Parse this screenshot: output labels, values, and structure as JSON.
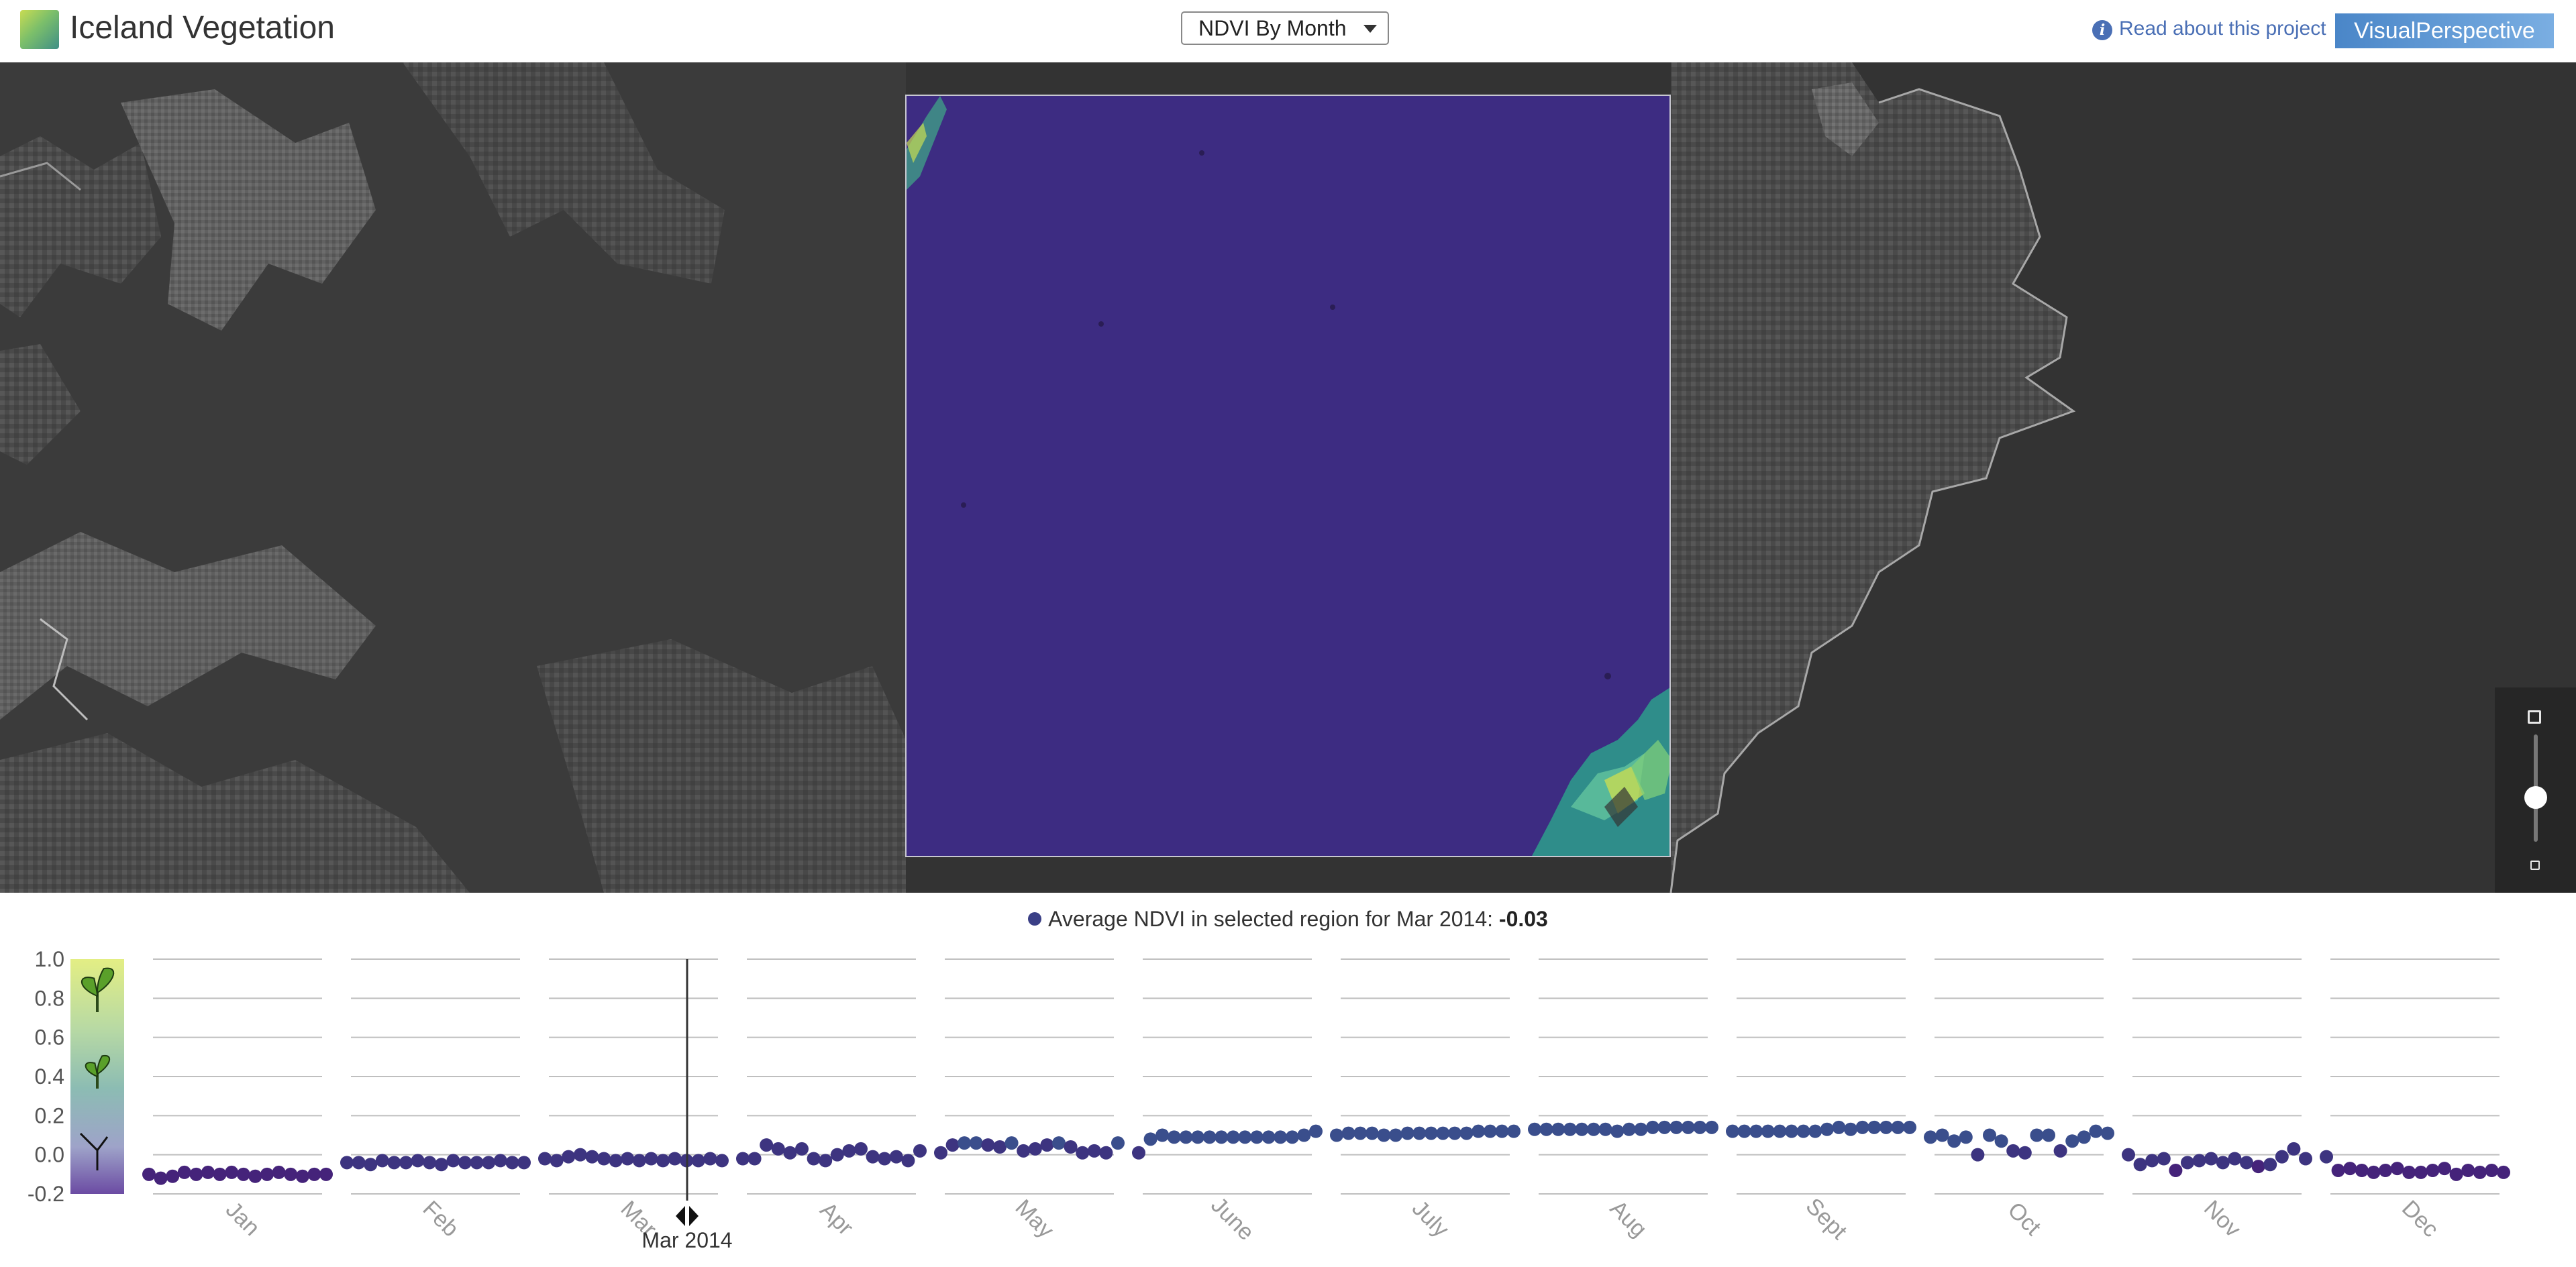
{
  "header": {
    "title": "Iceland Vegetation",
    "select_value": "NDVI By Month",
    "read_link": "Read about this project",
    "info_icon": "info-icon",
    "brand": "VisualPerspective"
  },
  "caption": {
    "prefix": "Average NDVI in selected region for Mar 2014:",
    "value": "-0.03"
  },
  "colors": {
    "low_ndvi": "#3d2c82",
    "series_dot": "#3a3f86",
    "high_ndvi": "#c8dc52"
  },
  "chart_data": {
    "type": "scatter",
    "title": "",
    "ylim": [
      -0.2,
      1.0
    ],
    "y_ticks": [
      "1.0",
      "0.8",
      "0.6",
      "0.4",
      "0.2",
      "0.0",
      "-0.2"
    ],
    "legend_icons": [
      "sprout-large-icon",
      "sprout-small-icon",
      "bare-stem-icon"
    ],
    "selected_label": "Mar 2014",
    "months": [
      {
        "label": "Jan",
        "values": [
          -0.1,
          -0.12,
          -0.11,
          -0.09,
          -0.1,
          -0.09,
          -0.1,
          -0.09,
          -0.1,
          -0.11,
          -0.1,
          -0.09,
          -0.1,
          -0.11,
          -0.1,
          -0.1
        ]
      },
      {
        "label": "Feb",
        "values": [
          -0.04,
          -0.04,
          -0.05,
          -0.03,
          -0.04,
          -0.04,
          -0.03,
          -0.04,
          -0.05,
          -0.03,
          -0.04,
          -0.04,
          -0.04,
          -0.03,
          -0.04,
          -0.04
        ]
      },
      {
        "label": "Mar",
        "values": [
          -0.02,
          -0.03,
          -0.01,
          0.0,
          -0.01,
          -0.02,
          -0.03,
          -0.02,
          -0.03,
          -0.02,
          -0.03,
          -0.02,
          -0.03,
          -0.03,
          -0.02,
          -0.03
        ]
      },
      {
        "label": "Apr",
        "values": [
          -0.02,
          -0.02,
          0.05,
          0.03,
          0.01,
          0.03,
          -0.02,
          -0.03,
          0.0,
          0.02,
          0.03,
          -0.01,
          -0.02,
          -0.01,
          -0.03,
          0.02
        ]
      },
      {
        "label": "May",
        "values": [
          0.01,
          0.05,
          0.06,
          0.06,
          0.05,
          0.04,
          0.06,
          0.02,
          0.03,
          0.05,
          0.06,
          0.04,
          0.01,
          0.02,
          0.01,
          0.06
        ]
      },
      {
        "label": "June",
        "values": [
          0.01,
          0.08,
          0.1,
          0.09,
          0.09,
          0.09,
          0.09,
          0.09,
          0.09,
          0.09,
          0.09,
          0.09,
          0.09,
          0.09,
          0.1,
          0.12
        ]
      },
      {
        "label": "July",
        "values": [
          0.1,
          0.11,
          0.11,
          0.11,
          0.1,
          0.1,
          0.11,
          0.11,
          0.11,
          0.11,
          0.11,
          0.11,
          0.12,
          0.12,
          0.12,
          0.12
        ]
      },
      {
        "label": "Aug",
        "values": [
          0.13,
          0.13,
          0.13,
          0.13,
          0.13,
          0.13,
          0.13,
          0.12,
          0.13,
          0.13,
          0.14,
          0.14,
          0.14,
          0.14,
          0.14,
          0.14
        ]
      },
      {
        "label": "Sept",
        "values": [
          0.12,
          0.12,
          0.12,
          0.12,
          0.12,
          0.12,
          0.12,
          0.12,
          0.13,
          0.14,
          0.13,
          0.14,
          0.14,
          0.14,
          0.14,
          0.14
        ]
      },
      {
        "label": "Oct",
        "values": [
          0.09,
          0.1,
          0.07,
          0.09,
          0.0,
          0.1,
          0.07,
          0.02,
          0.01,
          0.1,
          0.1,
          0.02,
          0.07,
          0.09,
          0.12,
          0.11
        ]
      },
      {
        "label": "Nov",
        "values": [
          0.0,
          -0.05,
          -0.03,
          -0.02,
          -0.08,
          -0.04,
          -0.03,
          -0.02,
          -0.04,
          -0.02,
          -0.04,
          -0.06,
          -0.05,
          -0.01,
          0.03,
          -0.02
        ]
      },
      {
        "label": "Dec",
        "values": [
          -0.01,
          -0.08,
          -0.07,
          -0.08,
          -0.09,
          -0.08,
          -0.07,
          -0.09,
          -0.09,
          -0.08,
          -0.07,
          -0.1,
          -0.08,
          -0.09,
          -0.08,
          -0.09
        ]
      }
    ]
  }
}
